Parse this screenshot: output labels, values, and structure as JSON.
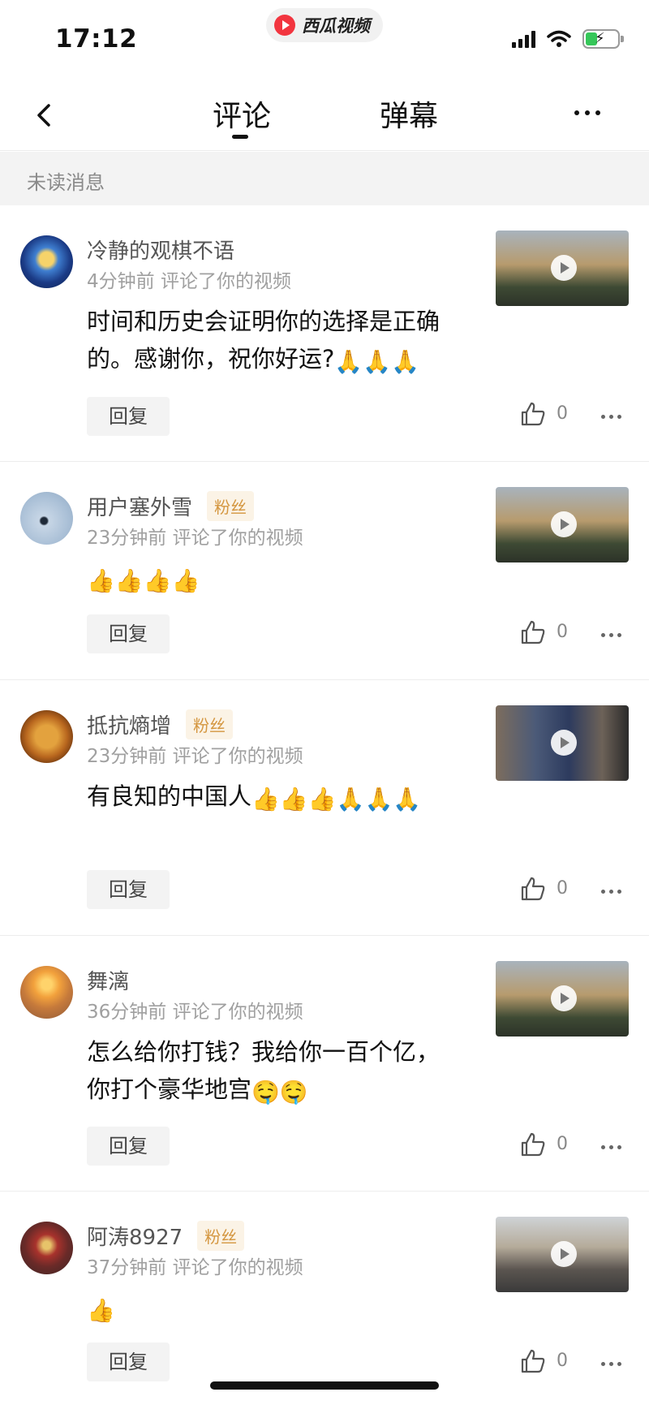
{
  "status_bar": {
    "time": "17:12",
    "app_name": "西瓜视频",
    "icons": [
      "signal-icon",
      "wifi-icon",
      "battery-charging-icon"
    ]
  },
  "nav": {
    "tabs": [
      {
        "label": "评论",
        "active": true
      },
      {
        "label": "弹幕",
        "active": false
      }
    ],
    "icons": [
      "back-chevron-icon",
      "more-icon"
    ]
  },
  "section": {
    "title": "未读消息"
  },
  "colors": {
    "accent_badge": "#d4963f",
    "badge_bg": "#fbf3e6",
    "meta_gray": "#a0a0a0"
  },
  "comments": [
    {
      "username": "冷静的观棋不语",
      "fan_badge": "",
      "time": "4分钟前",
      "action": "评论了你的视频",
      "text": "时间和历史会证明你的选择是正确的。感谢你，祝你好运?",
      "emojis": "🙏🙏🙏",
      "reply_label": "回复",
      "likes": "0"
    },
    {
      "username": "用户塞外雪",
      "fan_badge": "粉丝",
      "time": "23分钟前",
      "action": "评论了你的视频",
      "text": "",
      "emojis": "👍👍👍👍",
      "reply_label": "回复",
      "likes": "0"
    },
    {
      "username": "抵抗熵增",
      "fan_badge": "粉丝",
      "time": "23分钟前",
      "action": "评论了你的视频",
      "text": "有良知的中国人",
      "emojis": "👍👍👍🙏🙏🙏",
      "reply_label": "回复",
      "likes": "0"
    },
    {
      "username": "舞漓",
      "fan_badge": "",
      "time": "36分钟前",
      "action": "评论了你的视频",
      "text": "怎么给你打钱？我给你一百个亿，你打个豪华地宫",
      "emojis": "🤤🤤",
      "reply_label": "回复",
      "likes": "0"
    },
    {
      "username": "阿涛8927",
      "fan_badge": "粉丝",
      "time": "37分钟前",
      "action": "评论了你的视频",
      "text": "",
      "emojis": "👍",
      "reply_label": "回复",
      "likes": "0"
    }
  ]
}
